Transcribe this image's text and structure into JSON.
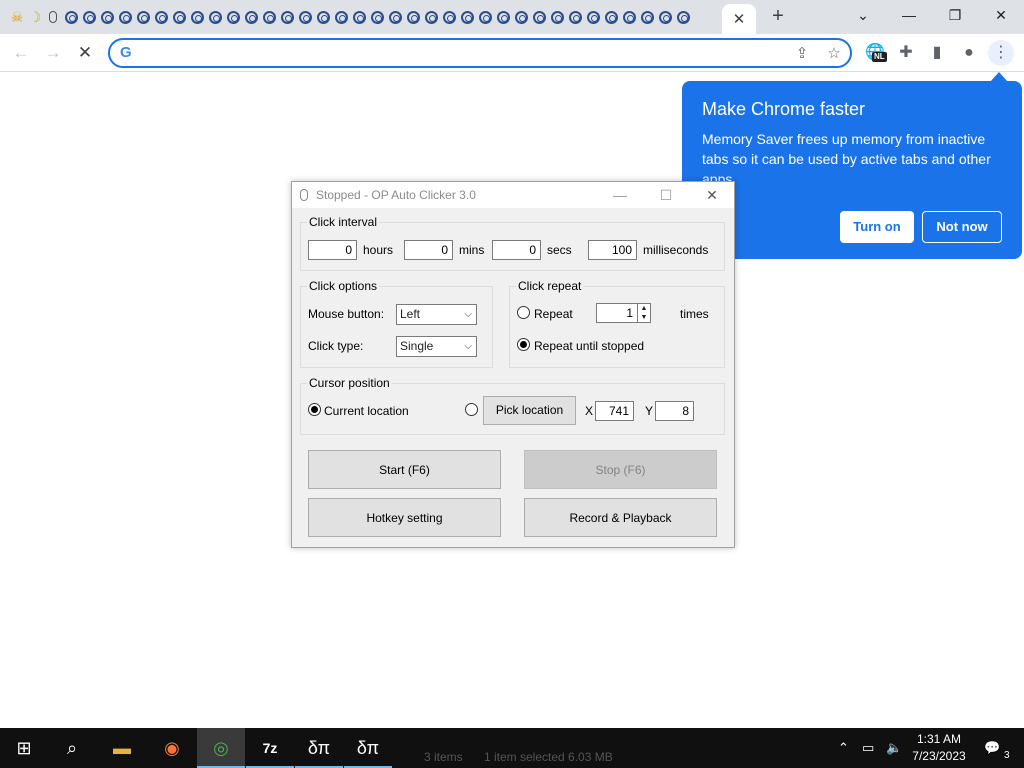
{
  "browser": {
    "omnibox": {
      "value": "",
      "placeholder": ""
    },
    "extension_badge": "NL"
  },
  "promo": {
    "title": "Make Chrome faster",
    "body": "Memory Saver frees up memory from inactive tabs so it can be used by active tabs and other apps.",
    "turn_on": "Turn on",
    "not_now": "Not now"
  },
  "app": {
    "title": "Stopped - OP Auto Clicker 3.0",
    "click_interval": {
      "label": "Click interval",
      "hours": "0",
      "hours_label": "hours",
      "mins": "0",
      "mins_label": "mins",
      "secs": "0",
      "secs_label": "secs",
      "ms": "100",
      "ms_label": "milliseconds"
    },
    "click_options": {
      "label": "Click options",
      "mouse_button_label": "Mouse button:",
      "mouse_button": "Left",
      "click_type_label": "Click type:",
      "click_type": "Single"
    },
    "click_repeat": {
      "label": "Click repeat",
      "repeat_label": "Repeat",
      "times_value": "1",
      "times_label": "times",
      "until_stopped_label": "Repeat until stopped",
      "selected": "until_stopped"
    },
    "cursor_position": {
      "label": "Cursor position",
      "current_label": "Current location",
      "pick_label": "Pick location",
      "x_label": "X",
      "x_value": "741",
      "y_label": "Y",
      "y_value": "8",
      "selected": "current"
    },
    "buttons": {
      "start": "Start (F6)",
      "stop": "Stop (F6)",
      "hotkey": "Hotkey setting",
      "record": "Record & Playback"
    }
  },
  "taskbar": {
    "ghost_items": "3 items",
    "ghost_selected": "1 item selected  6.03 MB",
    "apps": [
      {
        "name": "7z",
        "label": "7z"
      },
      {
        "name": "app-1",
        "label": "δπ"
      },
      {
        "name": "app-2",
        "label": "δπ"
      }
    ],
    "time": "1:31 AM",
    "date": "7/23/2023",
    "notifications": "3"
  },
  "colors": {
    "chrome_blue": "#1a73e8",
    "tabstrip": "#dee1e6",
    "dialog_bg": "#f0f0f0",
    "taskbar": "#101010"
  }
}
